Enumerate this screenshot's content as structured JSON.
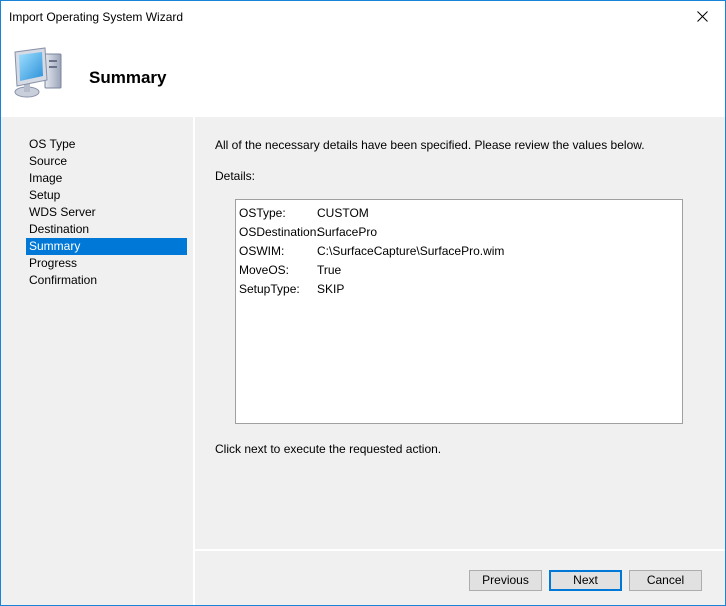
{
  "window": {
    "title": "Import Operating System Wizard",
    "close_icon": "close-icon"
  },
  "header": {
    "title": "Summary",
    "icon": "computer-icon"
  },
  "nav": {
    "items": [
      {
        "label": "OS Type",
        "active": false
      },
      {
        "label": "Source",
        "active": false
      },
      {
        "label": "Image",
        "active": false
      },
      {
        "label": "Setup",
        "active": false
      },
      {
        "label": "WDS Server",
        "active": false
      },
      {
        "label": "Destination",
        "active": false
      },
      {
        "label": "Summary",
        "active": true
      },
      {
        "label": "Progress",
        "active": false
      },
      {
        "label": "Confirmation",
        "active": false
      }
    ]
  },
  "main": {
    "intro": "All of the necessary details have been specified.  Please review the values below.",
    "details_label": "Details:",
    "details": [
      {
        "key": "OSType:",
        "value": "CUSTOM"
      },
      {
        "key": "OSDestination:",
        "value": "SurfacePro"
      },
      {
        "key": "OSWIM:",
        "value": "C:\\SurfaceCapture\\SurfacePro.wim"
      },
      {
        "key": "MoveOS:",
        "value": "True"
      },
      {
        "key": "SetupType:",
        "value": "SKIP"
      }
    ],
    "footer_note": "Click next to execute the requested action."
  },
  "buttons": {
    "previous": "Previous",
    "next": "Next",
    "cancel": "Cancel"
  },
  "colors": {
    "accent": "#0078d7",
    "window_border": "#1883d7"
  }
}
